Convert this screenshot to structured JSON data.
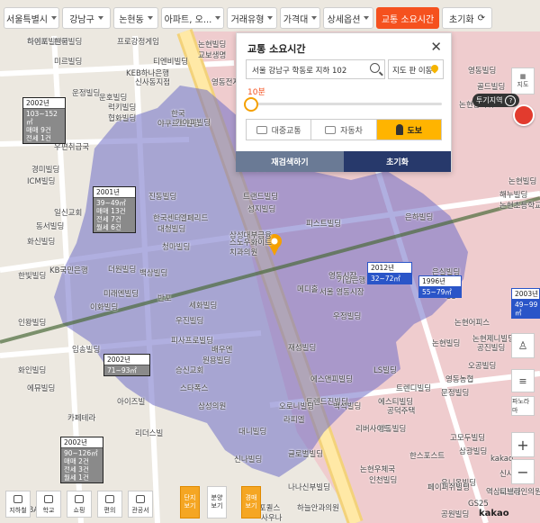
{
  "filters": {
    "region_city": "서울특별시",
    "region_gu": "강남구",
    "region_dong": "논현동",
    "property_type": "아파트, 오...",
    "deal_type": "거래유형",
    "price": "가격대",
    "detail": "상세옵션",
    "transit_time": "교통 소요시간",
    "reset": "초기화"
  },
  "panel": {
    "title": "교통 소요시간",
    "address_value": "서울 강남구 학동로 지하 102",
    "map_select_label": "지도 판 이동",
    "time_label": "10분",
    "time_fraction": 0.0,
    "modes": [
      "대중교통",
      "자동차",
      "도보"
    ],
    "selected_mode": "도보",
    "research_label": "재검색하기",
    "reset_label": "초기화"
  },
  "places": [
    "티엔비빌딩",
    "논현빌딩",
    "프로강정게임",
    "미르빌딩",
    "티엔비빌딩",
    "KEB하나은행",
    "신사동지점",
    "운정빌딩",
    "운호빌딩",
    "럭키빌딩",
    "협화빌딩",
    "한국",
    "야쿠르트빌딩",
    "우편취급국",
    "경미빌딩",
    "ICM빌딩",
    "일신교회",
    "동서빌딩",
    "화신빌딩",
    "KB국민은행",
    "한빛빌딩",
    "인왕빌딩",
    "임송빌딩",
    "화인빌딩",
    "에뮤빌딩",
    "카페테라",
    "아이즈빌",
    "리더스빌",
    "진동빌딩",
    "한국센터",
    "대청빌딩",
    "엘페리드",
    "스노우화이트",
    "치과의원",
    "청마빌딩",
    "더원빌딩",
    "백상빌딩",
    "미래엔빌딩",
    "이화빌딩",
    "반포",
    "세화빌딩",
    "우진빌딩",
    "피사프로빌딩",
    "배우엔",
    "원용빌딩",
    "승신교회",
    "스타폭스",
    "삼성의원",
    "대니빌딩",
    "신나빌딩",
    "나나신부빌딩",
    "하늘안과의원",
    "반포퀼스",
    "사우나",
    "메디",
    "트랜드빌딩",
    "성지빌딩",
    "피스트빌딩",
    "삼성대부금융",
    "기업은행",
    "영동시장",
    "메디홀",
    "서울 영동시장",
    "우정빌딩",
    "재성빌딩",
    "에스앤피빌딩",
    "트렌드진빌딩",
    "오로니빌딩",
    "라피엘",
    "공덕주택",
    "영동빌딩",
    "논현빌딩",
    "LS빌딩",
    "백석빌딩",
    "은하빌딩",
    "은실빌딩",
    "CU",
    "논현어피스",
    "논현제니빌딩",
    "공진빌딩",
    "오공빌딩",
    "영동농협",
    "문정빌딩",
    "트렌디빌딩",
    "에스티빌딩",
    "리버사이드",
    "글로벌빌딩",
    "한스포스트",
    "유니온빌딩",
    "고모두빌딩",
    "삼광빌딩",
    "영동빌딩",
    "골드빌딩",
    "논현동타워",
    "논현빌딩",
    "해누빌딩",
    "논현초등학교",
    "신사중학교",
    "역삼로빌딩",
    "논현우체국",
    "인천빌딩",
    "페이퍼쉬빌딩",
    "공원빌딩",
    "다인ABA",
    "GS25",
    "kakao",
    "디브라인의원",
    "논현빌딩",
    "교보생명",
    "영동전자",
    "영안빌딩",
    "가야피빌딩",
    "하이포",
    "한국"
  ],
  "info_boxes": [
    {
      "year": "2002년",
      "lines": [
        "103~152㎡",
        "매매 9건",
        "전세 1건"
      ],
      "style": "gray"
    },
    {
      "year": "2001년",
      "lines": [
        "39~49㎡",
        "매매 13건",
        "전세 7건",
        "월세 6건"
      ],
      "style": "gray"
    },
    {
      "year": "2002년",
      "lines": [
        "71~93㎡"
      ],
      "style": "gray"
    },
    {
      "year": "2002년",
      "lines": [
        "90~126㎡",
        "매매 2건",
        "전세 3건",
        "월세 1건"
      ],
      "style": "gray"
    },
    {
      "year": "2012년",
      "lines": [
        "32~72㎡"
      ],
      "style": "blue"
    },
    {
      "year": "1996년",
      "lines": [
        "55~79㎡"
      ],
      "style": "blue"
    },
    {
      "year": "2003년",
      "lines": [
        "49~99㎡"
      ],
      "style": "blue"
    }
  ],
  "right_tools": {
    "map_label": "지도",
    "invest_label": "투기지역",
    "invest_badge": "?",
    "street_label": "거리",
    "scale_label": "파노라마"
  },
  "bottom_tools": [
    "지하철",
    "학교",
    "쇼핑",
    "편의",
    "관공서"
  ],
  "bottom_buttons": [
    {
      "label": "단지\n보기",
      "style": "orange"
    },
    {
      "label": "분양\n보기",
      "style": "white"
    },
    {
      "label": "경매\n보기",
      "style": "orange"
    }
  ],
  "map_footer": {
    "logo": "kakao"
  },
  "colors": {
    "accent": "#f5511e",
    "zone_purple": "#7a73c9",
    "zone_pink": "#d8a0ae",
    "panel_reset": "#27396b",
    "panel_research": "#6a7a95",
    "walk_selected": "#ffb400"
  }
}
